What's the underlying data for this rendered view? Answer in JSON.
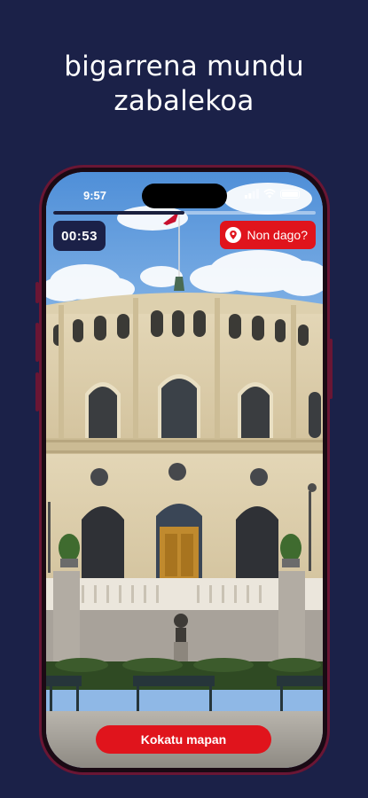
{
  "headline": {
    "line1": "bigarrena mundu",
    "line2": "zabalekoa"
  },
  "status_bar": {
    "time": "9:57",
    "icons": [
      "signal-icon",
      "wifi-icon",
      "battery-icon"
    ]
  },
  "game": {
    "progress_fraction": 0.5,
    "timer": "00:53",
    "where_button_label": "Non dago?",
    "where_button_icon": "location-pin-icon",
    "place_on_map_label": "Kokatu mapan"
  },
  "colors": {
    "background": "#1b2148",
    "accent_red": "#e0141c",
    "phone_frame": "#6a1634"
  }
}
